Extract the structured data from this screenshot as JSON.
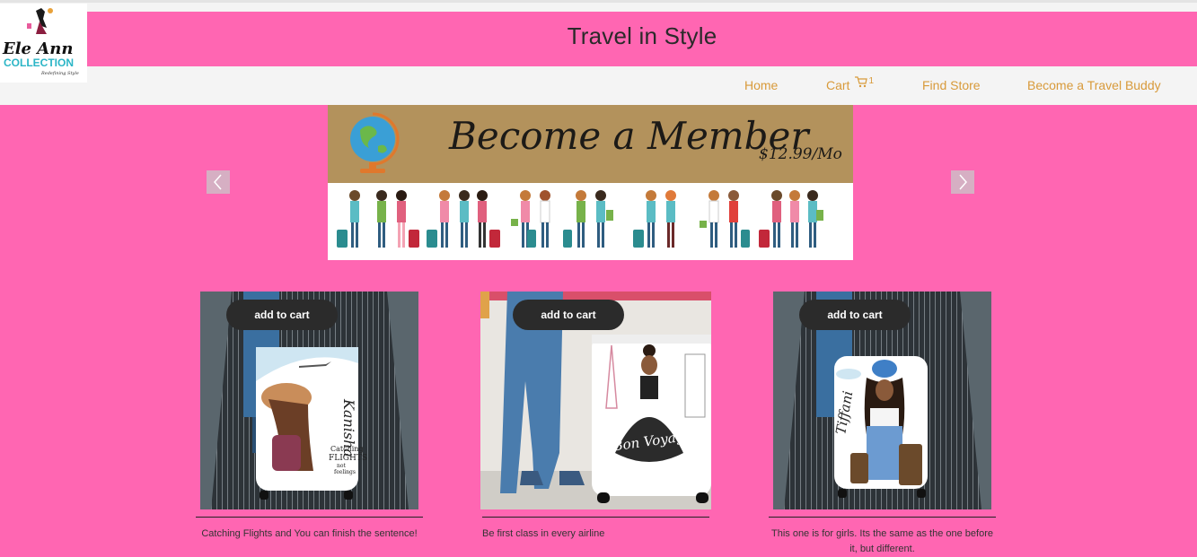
{
  "brand": {
    "logo_line1": "Ele Ann",
    "logo_line2": "COLLECTION",
    "logo_tagline": "Redefining Style",
    "site_title": "Travel in Style"
  },
  "nav": {
    "home": "Home",
    "cart": "Cart",
    "cart_count": "1",
    "find_store": "Find Store",
    "become_buddy": "Become a Travel Buddy"
  },
  "banner": {
    "title": "Become a Member",
    "price": "$12.99/Mo"
  },
  "products": [
    {
      "button": "add to cart",
      "caption": "Catching Flights and You can finish the sentence!",
      "cover_name": "Kanisha",
      "cover_text": "Catching FLIGHTS not feelings"
    },
    {
      "button": "add to cart",
      "caption": "Be first class in every airline",
      "cover_name": "",
      "cover_text": "Bon Voyage"
    },
    {
      "button": "add to cart",
      "caption": "This one is for girls. Its the same as the one before it, but different.",
      "cover_name": "Tiffani",
      "cover_text": ""
    }
  ],
  "colors": {
    "page_bg": "#ff66b2",
    "nav_bg": "#f4f4f4",
    "nav_link": "#d89a3a",
    "banner_gold": "#b3925c",
    "button_dark": "#2b2b2b"
  }
}
